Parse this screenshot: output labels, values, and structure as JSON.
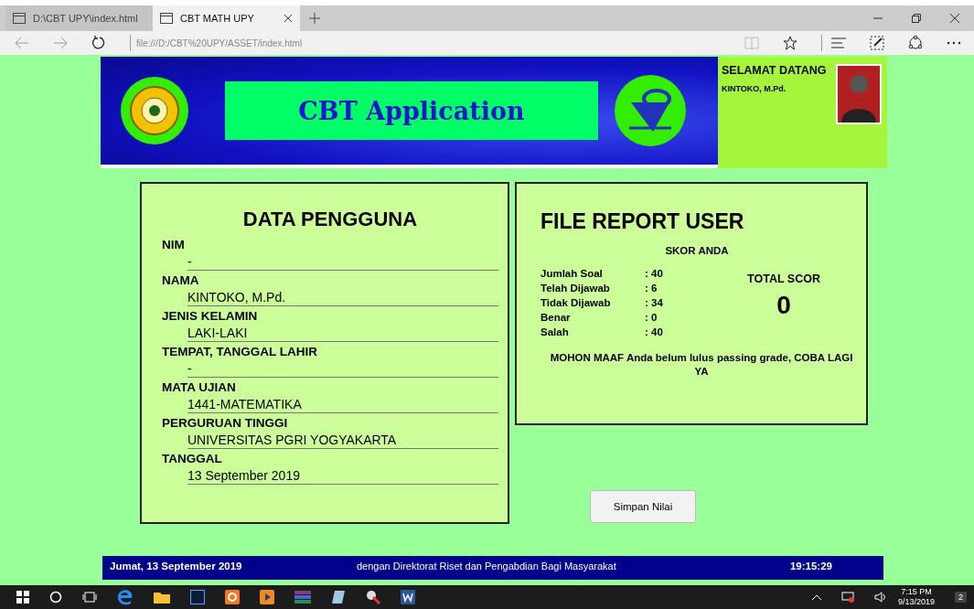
{
  "browser": {
    "tabs": [
      {
        "title": "D:\\CBT UPY\\index.html",
        "selected": false
      },
      {
        "title": "CBT MATH UPY",
        "selected": true
      }
    ],
    "address": "file:///D:/CBT%20UPY/ASSET/index.html"
  },
  "header": {
    "title": "CBT Application",
    "greeting": "SELAMAT DATANG",
    "user": "KINTOKO, M.Pd."
  },
  "user_card": {
    "title": "DATA PENGGUNA",
    "fields": [
      {
        "label": "NIM",
        "value": "-"
      },
      {
        "label": "NAMA",
        "value": "KINTOKO, M.Pd."
      },
      {
        "label": "JENIS KELAMIN",
        "value": "LAKI-LAKI"
      },
      {
        "label": "TEMPAT, TANGGAL LAHIR",
        "value": "-"
      },
      {
        "label": "MATA UJIAN",
        "value": "1441-MATEMATIKA"
      },
      {
        "label": "PERGURUAN TINGGI",
        "value": "UNIVERSITAS PGRI YOGYAKARTA"
      },
      {
        "label": "TANGGAL",
        "value": "13  September  2019"
      }
    ]
  },
  "report_card": {
    "title": "FILE REPORT  USER",
    "subtitle": "SKOR ANDA",
    "stats": [
      {
        "label": "Jumlah Soal",
        "value": ": 40"
      },
      {
        "label": "Telah Dijawab",
        "value": ": 6"
      },
      {
        "label": "Tidak Dijawab",
        "value": ": 34"
      },
      {
        "label": "Benar",
        "value": ": 0"
      },
      {
        "label": "Salah",
        "value": ": 40"
      }
    ],
    "total_label": "TOTAL SCOR",
    "total": "0",
    "message": "MOHON MAAF Anda belum lulus passing grade, COBA LAGI YA"
  },
  "save_button": "Simpan Nilai",
  "footer": {
    "date": "Jumat, 13  September  2019",
    "marquee": "dengan Direktorat Riset dan Pengabdian Bagi Masyarakat",
    "time": "19:15:29"
  },
  "taskbar": {
    "time": "7:15 PM",
    "date": "9/13/2019",
    "notifications": "2"
  }
}
